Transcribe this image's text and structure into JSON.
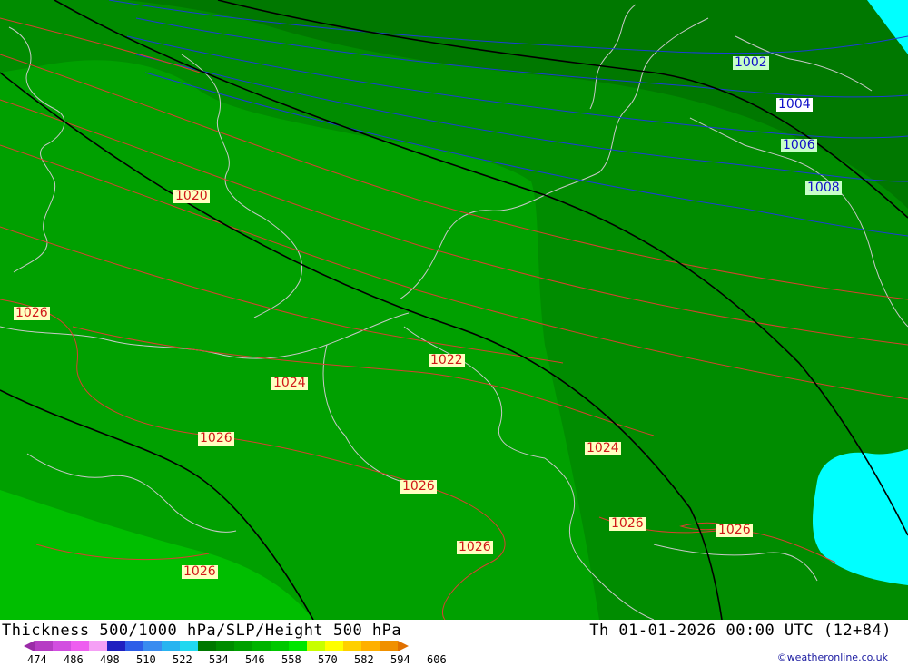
{
  "map": {
    "background_colors": {
      "thickness_546_558": "#00a000",
      "thickness_534_546": "#008c00",
      "thickness_522_534": "#007800",
      "thickness_558_570": "#00be00",
      "low_cyan": "#00ffff",
      "coastline": "#c8c8c8",
      "slp_high": "#d02020",
      "slp_low": "#1010c8",
      "height_500": "#000000"
    },
    "isobar_labels": [
      {
        "text": "1002",
        "style": "green"
      },
      {
        "text": "1004",
        "style": "blue"
      },
      {
        "text": "1006",
        "style": "green"
      },
      {
        "text": "1008",
        "style": "green"
      },
      {
        "text": "1020",
        "style": "red"
      },
      {
        "text": "1026",
        "style": "red"
      },
      {
        "text": "1022",
        "style": "red"
      },
      {
        "text": "1024",
        "style": "red"
      },
      {
        "text": "1026",
        "style": "red"
      },
      {
        "text": "1026",
        "style": "red"
      },
      {
        "text": "1024",
        "style": "red"
      },
      {
        "text": "1026",
        "style": "red"
      },
      {
        "text": "1026",
        "style": "red"
      },
      {
        "text": "1026",
        "style": "red"
      },
      {
        "text": "1026",
        "style": "red"
      }
    ]
  },
  "footer": {
    "title": "Thickness 500/1000 hPa/SLP/Height 500 hPa",
    "datetime": "Th 01-01-2026 00:00 UTC (12+84)",
    "credit": "©weatheronline.co.uk",
    "scale_colors": [
      "#9b2ba8",
      "#b63cc4",
      "#d24ee0",
      "#ee5ef0",
      "#f5a0f5",
      "#2020c0",
      "#2e5ee8",
      "#3a8cf0",
      "#28b4f0",
      "#20d8f0",
      "#007800",
      "#008c00",
      "#00a000",
      "#00b400",
      "#00c800",
      "#00e600",
      "#c8ff00",
      "#ffff00",
      "#ffd000",
      "#ffb000",
      "#f09000",
      "#e07000"
    ],
    "scale_ticks": [
      "474",
      "486",
      "498",
      "510",
      "522",
      "534",
      "546",
      "558",
      "570",
      "582",
      "594",
      "606"
    ]
  }
}
